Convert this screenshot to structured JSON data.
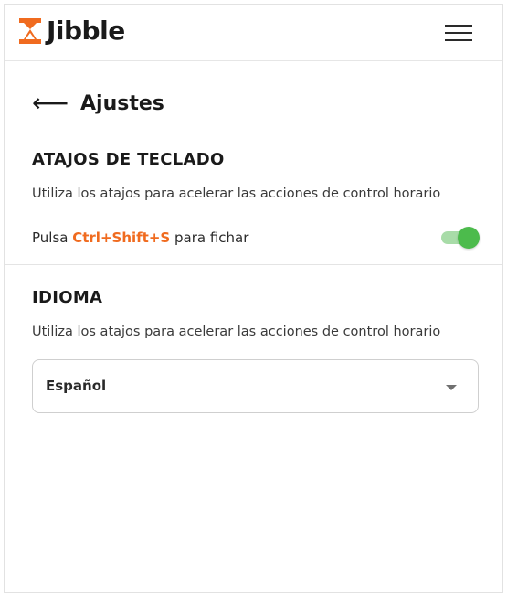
{
  "app": {
    "brand_name": "Jibble",
    "brand_color": "#f06b1f",
    "logo_icon": "hourglass-icon"
  },
  "header": {
    "menu_icon": "hamburger-menu-icon"
  },
  "page": {
    "back_icon": "⟵",
    "title": "Ajustes"
  },
  "shortcuts": {
    "heading": "ATAJOS DE TECLADO",
    "description": "Utiliza los atajos para acelerar las acciones de control horario",
    "label_prefix": "Pulsa ",
    "key_combo": "Ctrl+Shift+S",
    "label_suffix": " para fichar",
    "toggle_enabled": true,
    "toggle_color": "#4cbb4c"
  },
  "language": {
    "heading": "IDIOMA",
    "description": "Utiliza los atajos para acelerar las acciones de control horario",
    "selected": "Español"
  }
}
